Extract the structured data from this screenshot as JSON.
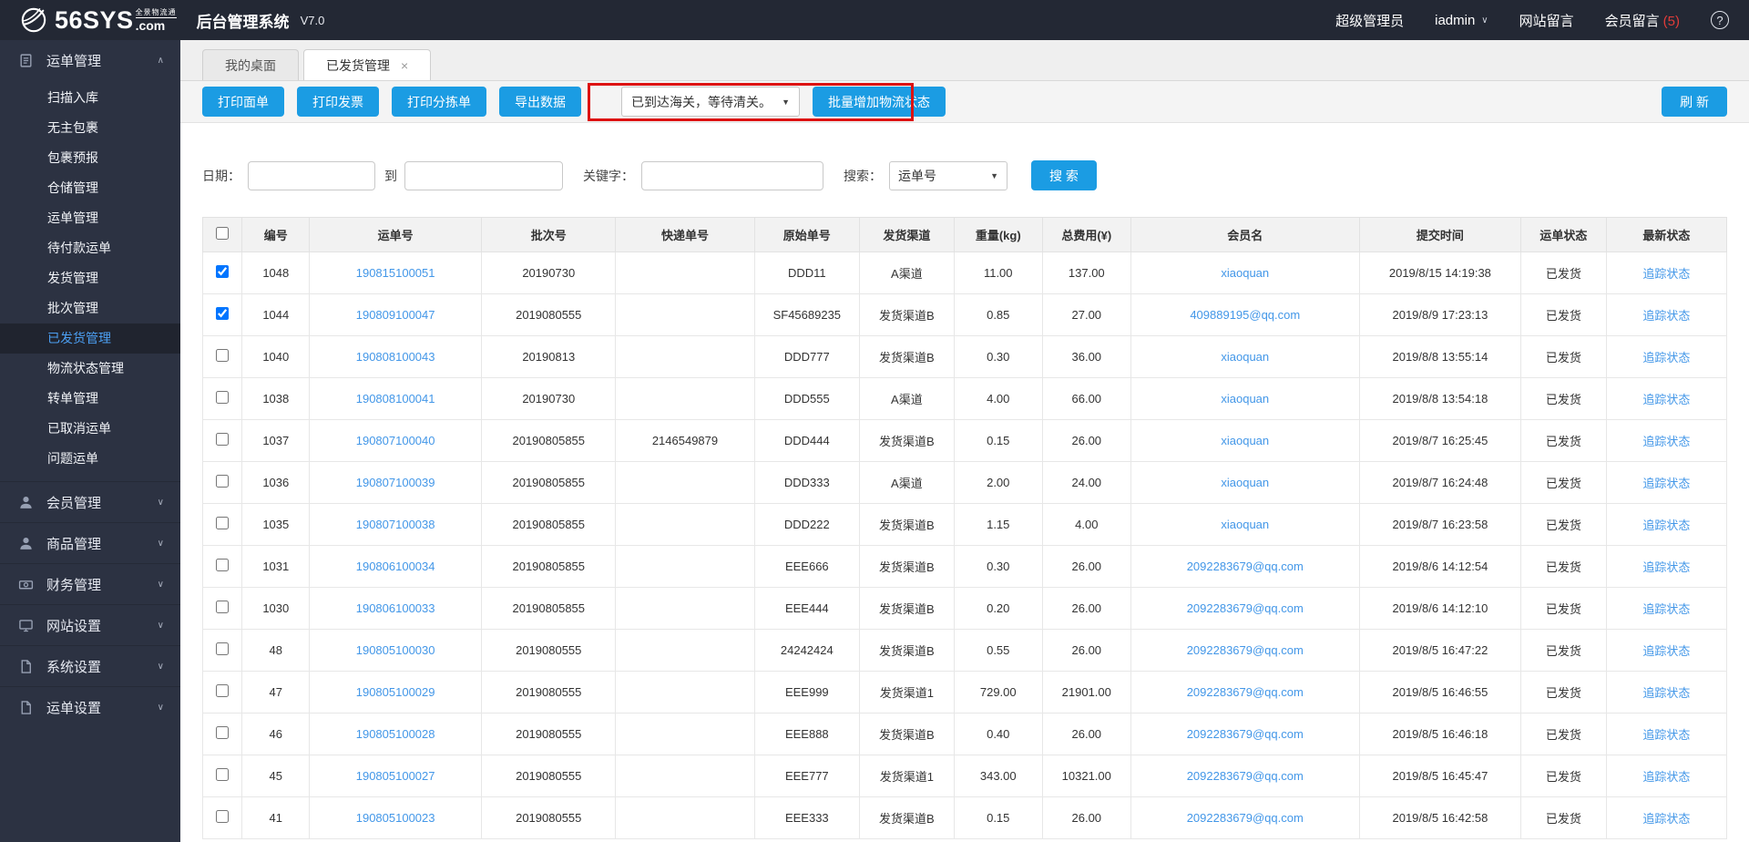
{
  "header": {
    "logo_text": "56SYS",
    "logo_tagline": "全景物流通",
    "logo_suffix": ".com",
    "app_title": "后台管理系统",
    "version": "V7.0",
    "role": "超级管理员",
    "username": "iadmin",
    "site_messages": "网站留言",
    "member_messages": "会员留言",
    "member_messages_count": "(5)"
  },
  "sidebar": {
    "groups": [
      {
        "key": "waybill-management",
        "label": "运单管理",
        "icon": "clipboard",
        "expanded": true,
        "active_item": "已发货管理",
        "items": [
          "扫描入库",
          "无主包裹",
          "包裹预报",
          "仓储管理",
          "运单管理",
          "待付款运单",
          "发货管理",
          "批次管理",
          "已发货管理",
          "物流状态管理",
          "转单管理",
          "已取消运单",
          "问题运单"
        ]
      },
      {
        "key": "member-management",
        "label": "会员管理",
        "icon": "user",
        "expanded": false
      },
      {
        "key": "product-management",
        "label": "商品管理",
        "icon": "user",
        "expanded": false
      },
      {
        "key": "finance-management",
        "label": "财务管理",
        "icon": "money",
        "expanded": false
      },
      {
        "key": "site-settings",
        "label": "网站设置",
        "icon": "monitor",
        "expanded": false
      },
      {
        "key": "system-settings",
        "label": "系统设置",
        "icon": "file",
        "expanded": false
      },
      {
        "key": "waybill-settings",
        "label": "运单设置",
        "icon": "file",
        "expanded": false
      }
    ]
  },
  "tabs": [
    {
      "label": "我的桌面",
      "active": false,
      "closable": false
    },
    {
      "label": "已发货管理",
      "active": true,
      "closable": true
    }
  ],
  "toolbar": {
    "buttons": [
      "打印面单",
      "打印发票",
      "打印分拣单",
      "导出数据"
    ],
    "status_dropdown_value": "已到达海关，等待清关。",
    "batch_button": "批量增加物流状态",
    "refresh_button": "刷 新"
  },
  "search": {
    "date_label": "日期：",
    "to_label": "到",
    "keyword_label": "关键字：",
    "search_by_label": "搜索：",
    "search_by_value": "运单号",
    "search_button": "搜 索"
  },
  "table": {
    "columns": [
      "编号",
      "运单号",
      "批次号",
      "快递单号",
      "原始单号",
      "发货渠道",
      "重量(kg)",
      "总费用(¥)",
      "会员名",
      "提交时间",
      "运单状态",
      "最新状态"
    ],
    "rows": [
      {
        "checked": true,
        "id": "1048",
        "waybill_no": "190815100051",
        "batch_no": "20190730",
        "express_no": "",
        "original_no": "DDD11",
        "channel": "A渠道",
        "weight": "11.00",
        "fee": "137.00",
        "member": "xiaoquan",
        "time": "2019/8/15 14:19:38",
        "status": "已发货",
        "latest": "追踪状态"
      },
      {
        "checked": true,
        "id": "1044",
        "waybill_no": "190809100047",
        "batch_no": "2019080555",
        "express_no": "",
        "original_no": "SF45689235",
        "channel": "发货渠道B",
        "weight": "0.85",
        "fee": "27.00",
        "member": "409889195@qq.com",
        "time": "2019/8/9 17:23:13",
        "status": "已发货",
        "latest": "追踪状态"
      },
      {
        "checked": false,
        "id": "1040",
        "waybill_no": "190808100043",
        "batch_no": "20190813",
        "express_no": "",
        "original_no": "DDD777",
        "channel": "发货渠道B",
        "weight": "0.30",
        "fee": "36.00",
        "member": "xiaoquan",
        "time": "2019/8/8 13:55:14",
        "status": "已发货",
        "latest": "追踪状态"
      },
      {
        "checked": false,
        "id": "1038",
        "waybill_no": "190808100041",
        "batch_no": "20190730",
        "express_no": "",
        "original_no": "DDD555",
        "channel": "A渠道",
        "weight": "4.00",
        "fee": "66.00",
        "member": "xiaoquan",
        "time": "2019/8/8 13:54:18",
        "status": "已发货",
        "latest": "追踪状态"
      },
      {
        "checked": false,
        "id": "1037",
        "waybill_no": "190807100040",
        "batch_no": "20190805855",
        "express_no": "2146549879",
        "original_no": "DDD444",
        "channel": "发货渠道B",
        "weight": "0.15",
        "fee": "26.00",
        "member": "xiaoquan",
        "time": "2019/8/7 16:25:45",
        "status": "已发货",
        "latest": "追踪状态"
      },
      {
        "checked": false,
        "id": "1036",
        "waybill_no": "190807100039",
        "batch_no": "20190805855",
        "express_no": "",
        "original_no": "DDD333",
        "channel": "A渠道",
        "weight": "2.00",
        "fee": "24.00",
        "member": "xiaoquan",
        "time": "2019/8/7 16:24:48",
        "status": "已发货",
        "latest": "追踪状态"
      },
      {
        "checked": false,
        "id": "1035",
        "waybill_no": "190807100038",
        "batch_no": "20190805855",
        "express_no": "",
        "original_no": "DDD222",
        "channel": "发货渠道B",
        "weight": "1.15",
        "fee": "4.00",
        "member": "xiaoquan",
        "time": "2019/8/7 16:23:58",
        "status": "已发货",
        "latest": "追踪状态"
      },
      {
        "checked": false,
        "id": "1031",
        "waybill_no": "190806100034",
        "batch_no": "20190805855",
        "express_no": "",
        "original_no": "EEE666",
        "channel": "发货渠道B",
        "weight": "0.30",
        "fee": "26.00",
        "member": "2092283679@qq.com",
        "time": "2019/8/6 14:12:54",
        "status": "已发货",
        "latest": "追踪状态"
      },
      {
        "checked": false,
        "id": "1030",
        "waybill_no": "190806100033",
        "batch_no": "20190805855",
        "express_no": "",
        "original_no": "EEE444",
        "channel": "发货渠道B",
        "weight": "0.20",
        "fee": "26.00",
        "member": "2092283679@qq.com",
        "time": "2019/8/6 14:12:10",
        "status": "已发货",
        "latest": "追踪状态"
      },
      {
        "checked": false,
        "id": "48",
        "waybill_no": "190805100030",
        "batch_no": "2019080555",
        "express_no": "",
        "original_no": "24242424",
        "channel": "发货渠道B",
        "weight": "0.55",
        "fee": "26.00",
        "member": "2092283679@qq.com",
        "time": "2019/8/5 16:47:22",
        "status": "已发货",
        "latest": "追踪状态"
      },
      {
        "checked": false,
        "id": "47",
        "waybill_no": "190805100029",
        "batch_no": "2019080555",
        "express_no": "",
        "original_no": "EEE999",
        "channel": "发货渠道1",
        "weight": "729.00",
        "fee": "21901.00",
        "member": "2092283679@qq.com",
        "time": "2019/8/5 16:46:55",
        "status": "已发货",
        "latest": "追踪状态"
      },
      {
        "checked": false,
        "id": "46",
        "waybill_no": "190805100028",
        "batch_no": "2019080555",
        "express_no": "",
        "original_no": "EEE888",
        "channel": "发货渠道B",
        "weight": "0.40",
        "fee": "26.00",
        "member": "2092283679@qq.com",
        "time": "2019/8/5 16:46:18",
        "status": "已发货",
        "latest": "追踪状态"
      },
      {
        "checked": false,
        "id": "45",
        "waybill_no": "190805100027",
        "batch_no": "2019080555",
        "express_no": "",
        "original_no": "EEE777",
        "channel": "发货渠道1",
        "weight": "343.00",
        "fee": "10321.00",
        "member": "2092283679@qq.com",
        "time": "2019/8/5 16:45:47",
        "status": "已发货",
        "latest": "追踪状态"
      },
      {
        "checked": false,
        "id": "41",
        "waybill_no": "190805100023",
        "batch_no": "2019080555",
        "express_no": "",
        "original_no": "EEE333",
        "channel": "发货渠道B",
        "weight": "0.15",
        "fee": "26.00",
        "member": "2092283679@qq.com",
        "time": "2019/8/5 16:42:58",
        "status": "已发货",
        "latest": "追踪状态"
      }
    ]
  },
  "colors": {
    "accent": "#1b9ce3",
    "link": "#4397e8",
    "red": "#dd1212",
    "topbar": "#232834",
    "sidebar": "#2c3242",
    "sidebar-active": "#20242f",
    "sidebar-active-text": "#4c9ff2"
  }
}
